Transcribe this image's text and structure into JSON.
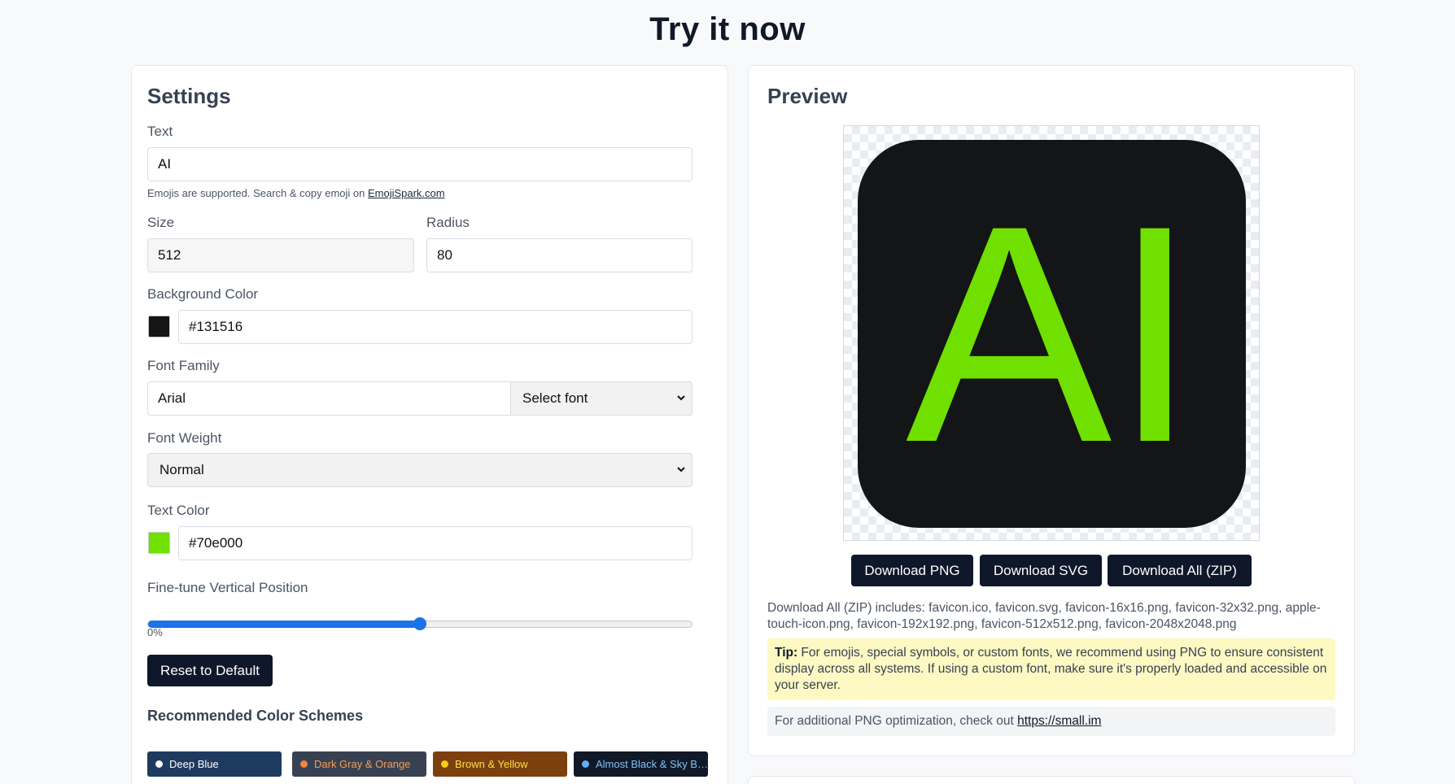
{
  "page_title": "Try it now",
  "settings": {
    "title": "Settings",
    "text_label": "Text",
    "text_value": "AI",
    "emoji_hint": "Emojis are supported. Search & copy emoji on ",
    "emoji_link": "EmojiSpark.com",
    "size_label": "Size",
    "size_value": "512",
    "radius_label": "Radius",
    "radius_value": "80",
    "bg_color_label": "Background Color",
    "bg_color_value": "#131516",
    "font_family_label": "Font Family",
    "font_family_value": "Arial",
    "font_select_label": "Select font",
    "font_weight_label": "Font Weight",
    "font_weight_value": "Normal",
    "text_color_label": "Text Color",
    "text_color_value": "#70e000",
    "vertical_label": "Fine-tune Vertical Position",
    "vertical_value": 0.5,
    "vertical_readout": "0%",
    "reset_label": "Reset to Default",
    "schemes_title": "Recommended Color Schemes",
    "schemes": [
      {
        "label": "Deep Blue",
        "bg": "#1e3a5f",
        "fg": "#ffffff",
        "dot": "#ffffff"
      },
      {
        "label": "Dark Gray & Orange",
        "bg": "#374151",
        "fg": "#f59e55",
        "dot": "#f4843c"
      },
      {
        "label": "Brown & Yellow",
        "bg": "#7c3f0e",
        "fg": "#fde047",
        "dot": "#facc15"
      },
      {
        "label": "Almost Black & Sky Blue",
        "bg": "#111827",
        "fg": "#7cc4f8",
        "dot": "#5fb3f5"
      }
    ]
  },
  "preview": {
    "title": "Preview",
    "icon_text": "AI",
    "icon_bg": "#131516",
    "icon_fg": "#70e000",
    "buttons": [
      "Download PNG",
      "Download SVG",
      "Download All (ZIP)"
    ],
    "zip_info": "Download All (ZIP) includes: favicon.ico, favicon.svg, favicon-16x16.png, favicon-32x32.png, apple-touch-icon.png, favicon-192x192.png, favicon-512x512.png, favicon-2048x2048.png",
    "tip_label": "Tip:",
    "tip_text": " For emojis, special symbols, or custom fonts, we recommend using PNG to ensure consistent display across all systems. If using a custom font, make sure it's properly loaded and accessible on your server.",
    "optim_text": "For additional PNG optimization, check out ",
    "optim_link": "https://small.im"
  }
}
